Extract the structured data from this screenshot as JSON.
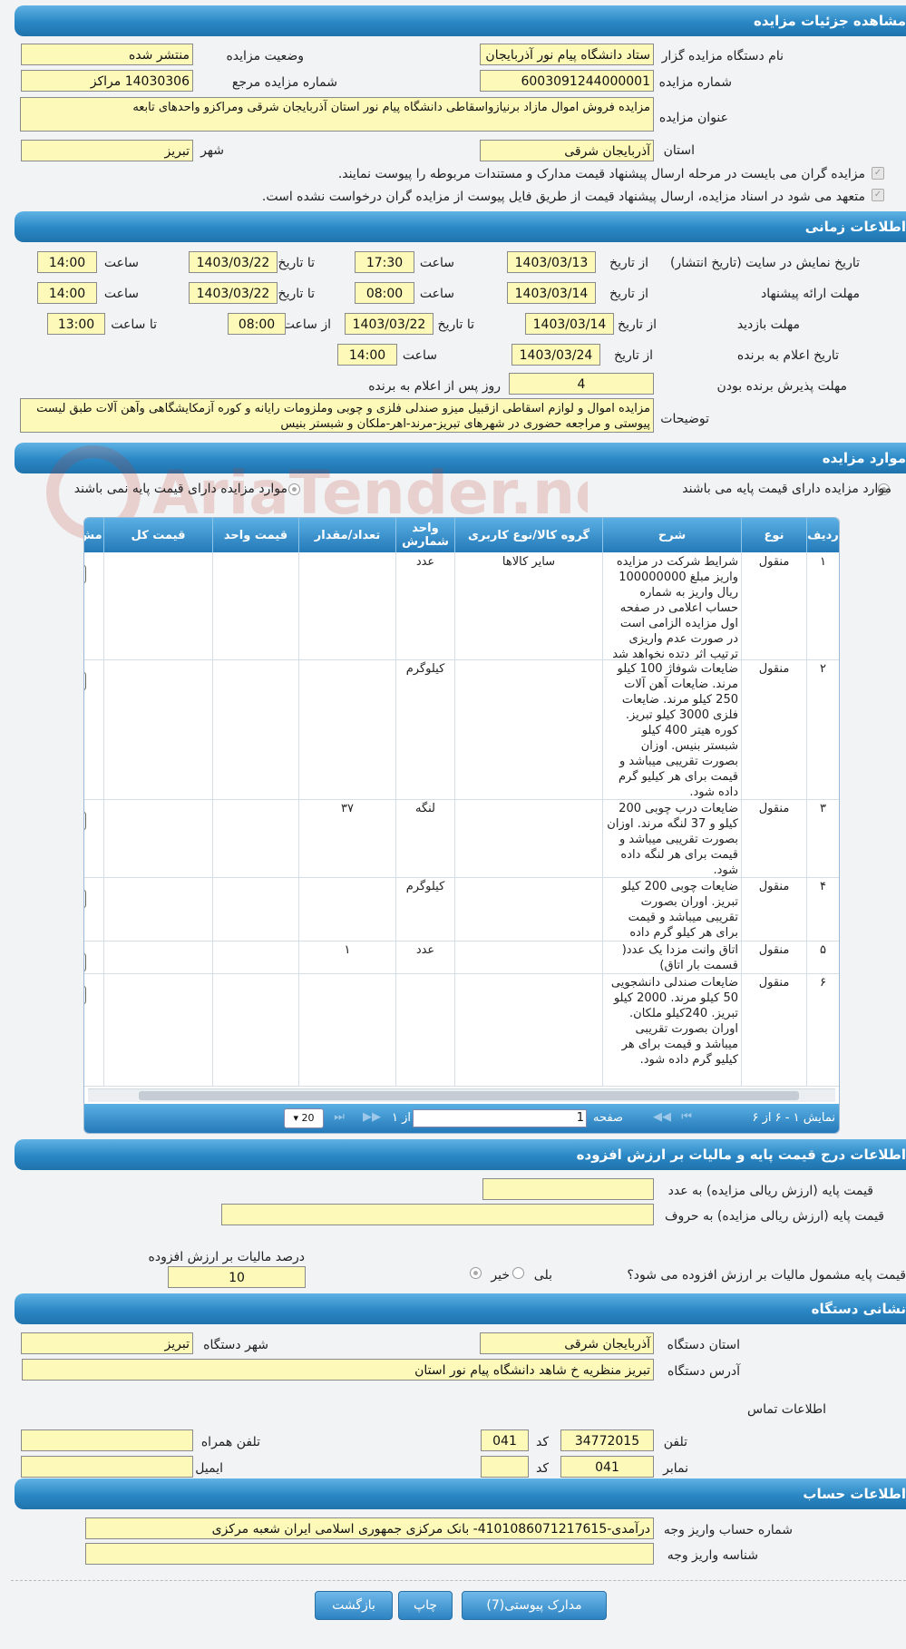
{
  "sections": {
    "details": "مشاهده جزئیات مزایده",
    "timing": "اطلاعات زمانی",
    "items": "موارد مزایده",
    "price": "اطلاعات درج قیمت پایه و مالیات بر ارزش افزوده",
    "address": "نشانی دستگاه",
    "account": "اطلاعات حساب"
  },
  "details": {
    "org_label": "نام دستگاه مزایده گزار",
    "org_value": "ستاد دانشگاه پیام نور آذربایجان شرقی",
    "status_label": "وضعیت مزایده",
    "status_value": "منتشر شده",
    "number_label": "شماره مزایده",
    "number_value": "6003091244000001",
    "ref_label": "شماره مزایده مرجع",
    "ref_value": "14030306 مراکز",
    "title_label": "عنوان مزایده",
    "title_value": "مزایده فروش اموال مازاد برنیازواسقاطی دانشگاه پیام نور استان آذربایجان شرقی ومراکزو واحدهای تابعه",
    "province_label": "استان",
    "province_value": "آذربایجان شرقی",
    "city_label": "شهر",
    "city_value": "تبریز",
    "check1": "مزایده گران می بایست در مرحله ارسال پیشنهاد قیمت مدارک و مستندات مربوطه را پیوست نمایند.",
    "check2": "متعهد می شود در اسناد مزایده، ارسال پیشنهاد قیمت از طریق فایل پیوست از مزایده گران درخواست نشده است."
  },
  "timing": {
    "r1_label": "تاریخ نمایش در سایت (تاریخ انتشار)",
    "from": "از تاریخ",
    "to": "تا تاریخ",
    "hour": "ساعت",
    "r1_from": "1403/03/13",
    "r1_from_time": "17:30",
    "r1_to": "1403/03/22",
    "r1_to_time": "14:00",
    "r2_label": "مهلت ارائه پیشنهاد",
    "r2_from": "1403/03/14",
    "r2_from_time": "08:00",
    "r2_to": "1403/03/22",
    "r2_to_time": "14:00",
    "r3_label": "مهلت بازدید",
    "r3_from": "1403/03/14",
    "r3_to": "1403/03/22",
    "from_hour": "از ساعت",
    "to_hour": "تا ساعت",
    "r3_from_time": "08:00",
    "r3_to_time": "13:00",
    "r4_label": "تاریخ اعلام به برنده",
    "r4_from": "1403/03/24",
    "r4_time": "14:00",
    "r5_label": "مهلت پذیرش برنده بودن",
    "r5_value": "4",
    "r5_suffix": "روز پس از اعلام به برنده",
    "notes_label": "توضیحات",
    "notes_value": "مزایده اموال و لوازم اسقاطی ازقبیل میزو صندلی فلزی و چوبی وملزومات رایانه و کوره آزمکایشگاهی وآهن آلات طبق لیست پیوستی و مراجعه حضوری در شهرهای تبریز-مرند-اهر-ملکان و شبستر بنیس"
  },
  "items": {
    "radio_has_price": "موارد مزایده دارای قیمت پایه می باشند",
    "radio_no_price": "موارد مزایده دارای قیمت پایه نمی باشند",
    "headers": {
      "row": "ردیف",
      "type": "نوع",
      "desc": "شرح",
      "group": "گروه کالا/نوع کاربری",
      "unit": "واحد شمارش",
      "qty": "تعداد/مقدار",
      "unit_price": "قیمت واحد",
      "total": "قیمت کل",
      "more": "مش"
    },
    "rows": [
      {
        "n": "۱",
        "type": "منقول",
        "desc": "شرایط شرکت در مزایده واریز مبلغ 100000000 ریال واریز به شماره حساب اعلامی در صفحه اول مزایده الزامی است در صورت عدم واریزی ترتیب اثر دتده نخواهد شد",
        "group": "سایر کالاها",
        "unit": "عدد",
        "qty": "",
        "unit_price": "",
        "total": ""
      },
      {
        "n": "۲",
        "type": "منقول",
        "desc": "ضایعات شوفاژ 100 کیلو مرند. ضایعات آهن آلات 250 کیلو مرند. ضایعات فلزی 3000 کیلو تبریز. کوره هیتر 400 کیلو شبستر بنیس. اوزان بصورت تقریبی میباشد و قیمت برای هر کیلیو گرم داده شود.",
        "group": "",
        "unit": "کیلوگرم",
        "qty": "",
        "unit_price": "",
        "total": ""
      },
      {
        "n": "۳",
        "type": "منقول",
        "desc": "ضایعات درب چوبی 200 کیلو و 37 لنگه مرند. اوزان بصورت تقریبی میباشد و قیمت برای هر لنگه داده شود.",
        "group": "",
        "unit": "لنگه",
        "qty": "۳۷",
        "unit_price": "",
        "total": ""
      },
      {
        "n": "۴",
        "type": "منقول",
        "desc": "ضایعات چوبی 200 کیلو تبریز. اوران بصورت تقریبی میباشد و قیمت برای هر کیلو گرم داده شود.",
        "group": "",
        "unit": "کیلوگرم",
        "qty": "",
        "unit_price": "",
        "total": ""
      },
      {
        "n": "۵",
        "type": "منقول",
        "desc": "اتاق وانت مزدا یک عدد( قسمت بار اتاق)",
        "group": "",
        "unit": "عدد",
        "qty": "۱",
        "unit_price": "",
        "total": ""
      },
      {
        "n": "۶",
        "type": "منقول",
        "desc": "ضایعات صندلی دانشجویی 50 کیلو مرند. 2000 کیلو تبریز. 240کیلو ملکان. اوران بصورت تقریبی میباشد و قیمت برای هر کیلیو گرم داده شود.",
        "group": "",
        "unit": "",
        "qty": "",
        "unit_price": "",
        "total": ""
      }
    ],
    "pager": {
      "showing": "نمایش ۱ - ۶ از ۶",
      "page_label": "صفحه",
      "page_value": "1",
      "of": "از ۱",
      "page_size": "20"
    }
  },
  "price": {
    "num_label": "قیمت پایه (ارزش ریالی مزایده) به عدد",
    "text_label": "قیمت پایه (ارزش ریالی مزایده) به حروف",
    "vat_question": "قیمت پایه مشمول مالیات بر ارزش افزوده می شود؟",
    "yes": "بلی",
    "no": "خیر",
    "vat_percent_label": "درصد مالیات بر ارزش افزوده",
    "vat_percent_value": "10"
  },
  "address": {
    "province_label": "استان دستگاه",
    "province_value": "آذربایجان شرقی",
    "city_label": "شهر دستگاه",
    "city_value": "تبریز",
    "addr_label": "آدرس دستگاه",
    "addr_value": "تبریز منظریه خ شاهد دانشگاه پیام نور استان",
    "contact_label": "اطلاعات تماس",
    "phone_label": "تلفن",
    "phone_value": "34772015",
    "code_label": "کد",
    "phone_code": "041",
    "mobile_label": "تلفن همراه",
    "fax_label": "نمابر",
    "fax_value": "041",
    "email_label": "ایمیل"
  },
  "account": {
    "acc_label": "شماره حساب واریز وجه",
    "acc_value": "درآمدی-4101086071217615- بانک مرکزی جمهوری اسلامی ایران شعبه مرکزی",
    "id_label": "شناسه واریز وجه"
  },
  "buttons": {
    "attachments": "مدارک پیوستی(7)",
    "print": "چاپ",
    "back": "بازگشت"
  },
  "watermark": "AriaTender.neT"
}
